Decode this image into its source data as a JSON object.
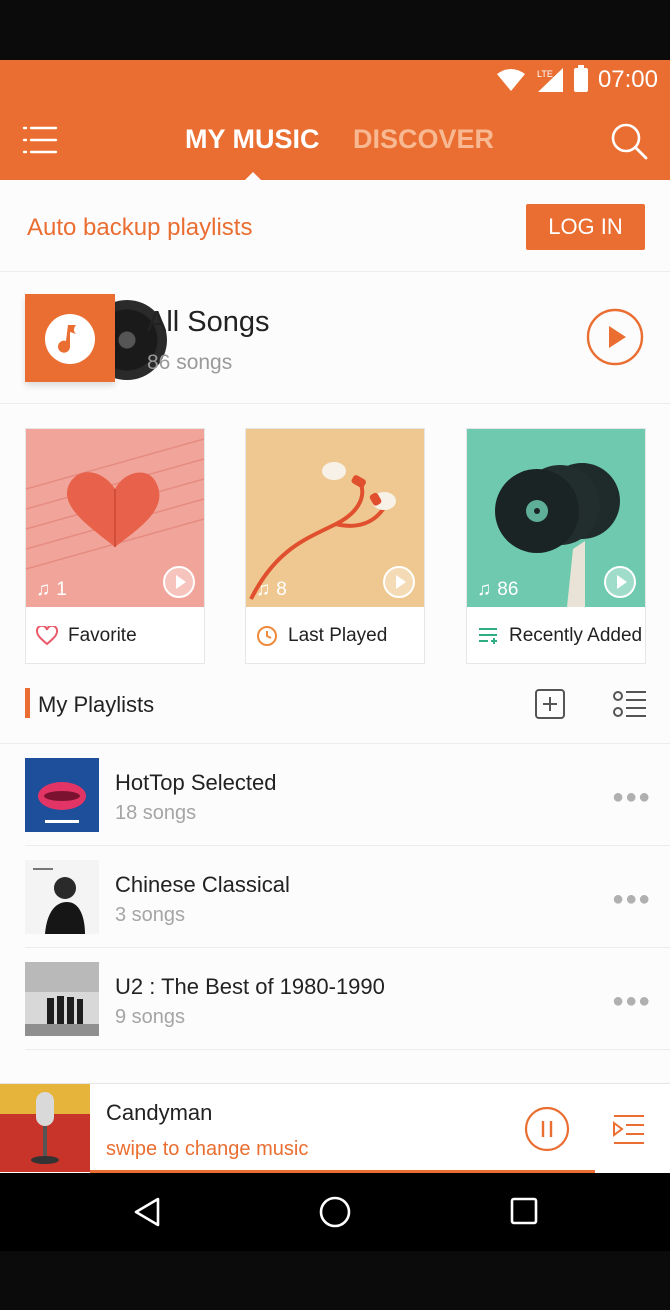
{
  "status_bar": {
    "time": "07:00",
    "network": "LTE"
  },
  "header": {
    "tabs": [
      {
        "label": "MY MUSIC",
        "active": true
      },
      {
        "label": "DISCOVER",
        "active": false
      }
    ]
  },
  "backup_banner": {
    "text": "Auto backup playlists",
    "button_label": "LOG IN"
  },
  "all_songs": {
    "title": "All Songs",
    "count_text": "86 songs"
  },
  "quick_cards": [
    {
      "label": "Favorite",
      "count": "1",
      "icon": "heart-icon"
    },
    {
      "label": "Last Played",
      "count": "8",
      "icon": "clock-icon"
    },
    {
      "label": "Recently Added",
      "count": "86",
      "icon": "recent-list-icon"
    }
  ],
  "my_playlists": {
    "title": "My Playlists",
    "items": [
      {
        "name": "HotTop Selected",
        "count_text": "18 songs"
      },
      {
        "name": "Chinese Classical",
        "count_text": "3 songs"
      },
      {
        "name": "U2 : The Best of 1980-1990",
        "count_text": "9 songs"
      }
    ]
  },
  "now_playing": {
    "title": "Candyman",
    "subtitle": "swipe to change music",
    "progress": 0.87
  },
  "colors": {
    "accent": "#ea6e31",
    "background": "#fcfcfd"
  }
}
